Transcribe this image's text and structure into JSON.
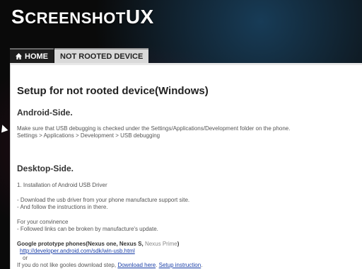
{
  "logo": {
    "first_letter": "S",
    "creen": "CREENSHOT",
    "ux": "UX"
  },
  "nav": {
    "home_label": "HOME",
    "not_rooted_label": "NOT ROOTED DEVICE"
  },
  "page": {
    "title": "Setup for not rooted device(Windows)",
    "android": {
      "heading": "Android-Side.",
      "line1": "Make sure that USB debugging is checked under the Settings/Applications/Development folder on the phone.",
      "line2": "Settings > Applications > Development > USB debugging"
    },
    "desktop": {
      "heading": "Desktop-Side.",
      "step1": "1. Installation of Android USB Driver",
      "dl1": "- Download the usb driver from your phone manufacture support site.",
      "dl2": "- And follow the instructions in there.",
      "conv1": "For your convinence",
      "conv2": "- Followed links can be broken by manufacture's update.",
      "google_prefix": "Google prototype phones(Nexus one, Nexus S,",
      "google_grey": "Nexus Prime",
      "google_suffix": ")",
      "url": "http://developer.android.com/sdk/win-usb.html",
      "or": "or",
      "last_prefix": "If you do not like gooles download step,",
      "download_here": "Download here",
      "setup_instruction": "Setup instruction"
    }
  },
  "colors": {
    "accent_link": "#1a3fa8",
    "home_tab_bg": "#1e1e1e",
    "tab_bg": "#d9d9d9"
  }
}
